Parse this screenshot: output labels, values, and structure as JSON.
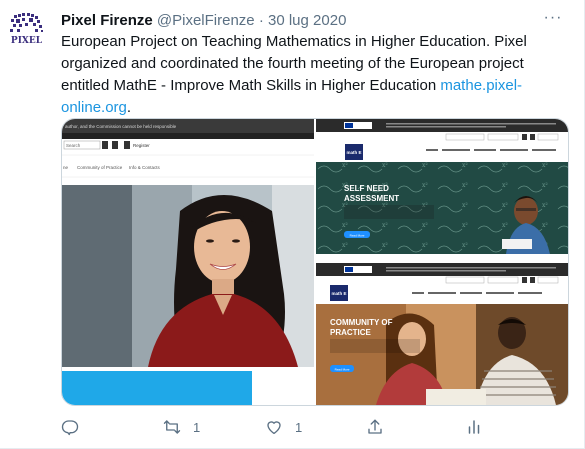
{
  "tweet": {
    "author_name": "Pixel Firenze",
    "author_handle": "@PixelFirenze",
    "separator": "·",
    "date": "30 lug 2020",
    "avatar_text": "PIXEL",
    "more_label": "···",
    "text_line1": "European Project on Teaching Mathematics in Higher Education. Pixel",
    "text_line2": "organized and coordinated the fourth meeting of the European project",
    "text_line3_pre": "entitled MathE - Improve Math Skills in Higher Education ",
    "text_line3_link": "mathe.pixel-",
    "text_line4_link": "online.org",
    "text_line4_post": "."
  },
  "media": {
    "left": {
      "top_bar_text": "author, and the Commission cannot be held responsible",
      "search_placeholder": "Search",
      "register_label": "Register",
      "nav_items": [
        "ne",
        "Community of Practice",
        "Info & Contacts"
      ]
    },
    "right_top": {
      "logo_text": "math E",
      "hero_title_1": "SELF NEED",
      "hero_title_2": "ASSESSMENT",
      "hero_sub": "The online platform to assess the evaluation of their knowledge of mathematics topic",
      "hero_button": "Read More"
    },
    "right_bottom": {
      "logo_text": "math E",
      "hero_title_1": "COMMUNITY OF",
      "hero_title_2": "PRACTICE",
      "hero_sub": "A virtual place to exchange teaching and learning experiences between students and teachers",
      "hero_button": "Read More"
    }
  },
  "actions": {
    "reply_count": "",
    "retweet_count": "1",
    "like_count": "1"
  },
  "colors": {
    "link": "#1b95e0",
    "muted": "#5b7083",
    "mathe_blue": "#1a2a6c",
    "accent_blue": "#1e90ff"
  }
}
